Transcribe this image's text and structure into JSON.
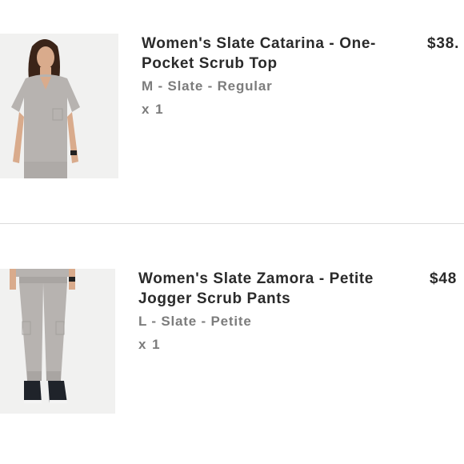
{
  "cart": {
    "items": [
      {
        "title": "Women's Slate Catarina - One-Pocket Scrub Top",
        "variant": "M - Slate - Regular",
        "quantity": "x 1",
        "price": "$38.",
        "image_icon": "scrub-top-photo"
      },
      {
        "title": "Women's Slate Zamora - Petite Jogger Scrub Pants",
        "variant": "L - Slate - Petite",
        "quantity": "x 1",
        "price": "$48",
        "image_icon": "jogger-pants-photo"
      }
    ]
  },
  "colors": {
    "slate_fabric": "#b7b3b0",
    "skin": "#d9ab8c",
    "hair": "#3b2418",
    "image_bg": "#f1f1f0",
    "text_dark": "#2a2a2a",
    "text_muted": "#7c7c7c"
  }
}
